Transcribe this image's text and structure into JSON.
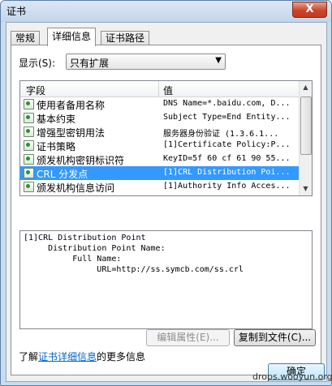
{
  "window": {
    "title": "证书",
    "close_label": "X"
  },
  "tabs": [
    {
      "label": "常规",
      "active": false
    },
    {
      "label": "详细信息",
      "active": true
    },
    {
      "label": "证书路径",
      "active": false
    }
  ],
  "show": {
    "label": "显示(S):",
    "selected": "只有扩展"
  },
  "list": {
    "columns": {
      "field": "字段",
      "value": "值"
    },
    "rows": [
      {
        "field": "使用者备用名称",
        "value": "DNS Name=*.baidu.com, D...",
        "selected": false
      },
      {
        "field": "基本约束",
        "value": "Subject Type=End Entity...",
        "selected": false
      },
      {
        "field": "增强型密钥用法",
        "value": "服务器身份验证 (1.3.6.1...",
        "selected": false
      },
      {
        "field": "证书策略",
        "value": "[1]Certificate Policy:P...",
        "selected": false
      },
      {
        "field": "颁发机构密钥标识符",
        "value": "KeyID=5f 60 cf 61 90 55...",
        "selected": false
      },
      {
        "field": "CRL 分发点",
        "value": "[1]CRL Distribution Poi...",
        "selected": true
      },
      {
        "field": "颁发机构信息访问",
        "value": "[1]Authority Info Acces...",
        "selected": false
      }
    ]
  },
  "detail": {
    "lines": [
      "[1]CRL Distribution Point",
      "     Distribution Point Name:",
      "          Full Name:",
      "               URL=http://ss.symcb.com/ss.crl"
    ]
  },
  "buttons": {
    "edit_properties": "编辑属性(E)...",
    "copy_to_file": "复制到文件(C)...",
    "ok": "确定"
  },
  "learn_more": {
    "prefix": "了解",
    "link": "证书详细信息",
    "suffix": "的更多信息"
  },
  "watermark": "drops.wooyun.org"
}
